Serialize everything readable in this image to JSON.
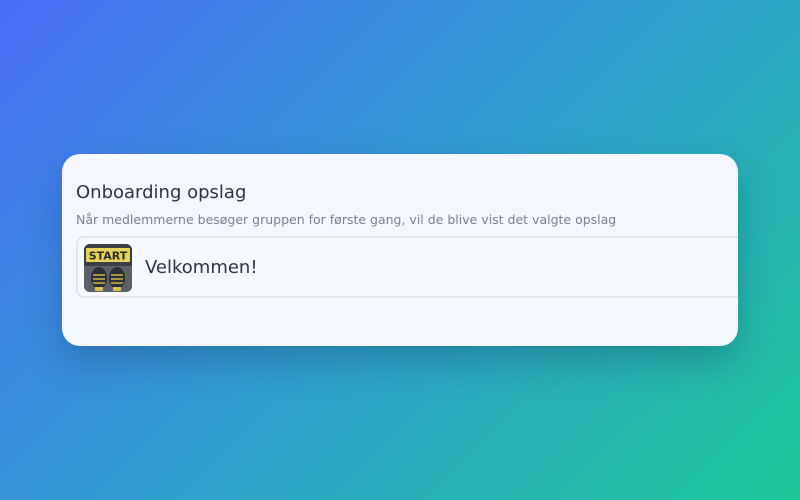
{
  "onboarding": {
    "title": "Onboarding opslag",
    "description": "Når medlemmerne besøger gruppen for første gang, vil de blive vist det valgte opslag",
    "selected_post": {
      "title": "Velkommen!",
      "thumbnail_text": "START",
      "thumbnail_icon": "start-line-shoes-image"
    }
  },
  "colors": {
    "gradient_start": "#4a6cf7",
    "gradient_end": "#1dc99a",
    "card_background": "#f4f7fe",
    "text_primary": "#2c3440",
    "text_secondary": "#7a818c",
    "row_border": "#dfe3ea"
  }
}
